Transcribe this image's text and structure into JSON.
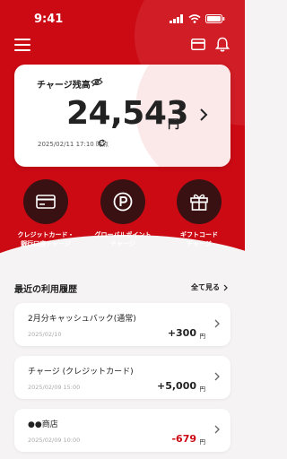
{
  "status": {
    "time": "9:41"
  },
  "balance": {
    "title": "チャージ残高",
    "amount": "24,543",
    "currency": "円",
    "updated": "2025/02/11 17:10 時点"
  },
  "actions": [
    {
      "line1": "クレジットカード・",
      "line2": "銀行口座チャージ",
      "icon": "credit-card-icon"
    },
    {
      "line1": "グローバルポイント",
      "line2": "チャージ",
      "icon": "points-icon"
    },
    {
      "line1": "ギフトコード",
      "line2": "チャージ",
      "icon": "gift-icon"
    }
  ],
  "history": {
    "title": "最近の利用履歴",
    "see_all": "全て見る",
    "items": [
      {
        "name": "2月分キャッシュバック(通常)",
        "date": "2025/02/10",
        "amount": "+300",
        "unit": "円"
      },
      {
        "name": "チャージ (クレジットカード)",
        "date": "2025/02/09 15:00",
        "amount": "+5,000",
        "unit": "円"
      },
      {
        "name": "●●商店",
        "date": "2025/02/09 10:00",
        "amount": "-679",
        "unit": "円"
      }
    ]
  },
  "colors": {
    "brand": "#cc0a14",
    "dark_circle": "#3a1113",
    "background": "#f5f3f3"
  }
}
